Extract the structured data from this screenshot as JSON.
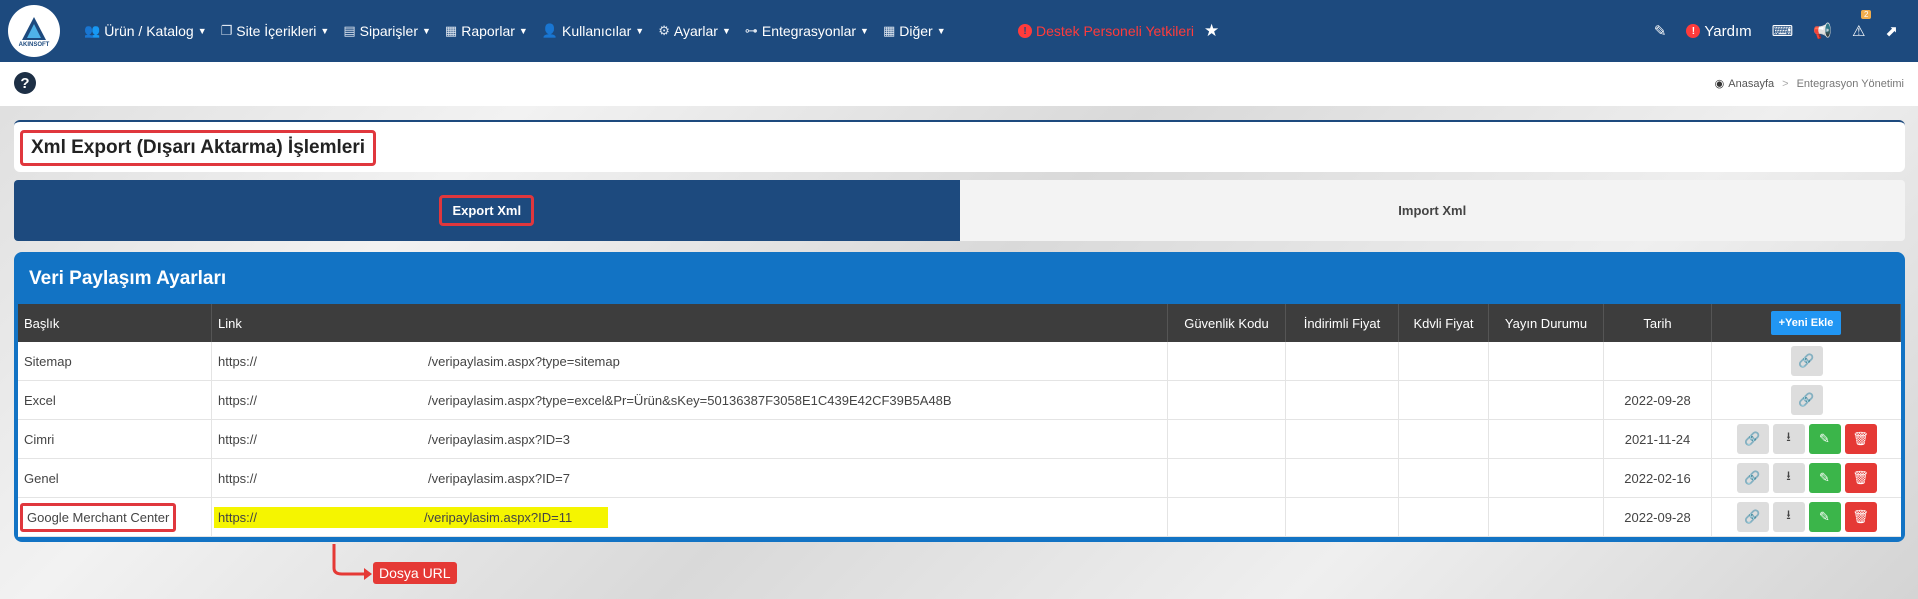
{
  "nav": {
    "logo_text": "AKINSOFT",
    "items": [
      {
        "label": "Ürün / Katalog",
        "icon": "group-icon"
      },
      {
        "label": "Site İçerikleri",
        "icon": "copy-icon"
      },
      {
        "label": "Siparişler",
        "icon": "cart-icon"
      },
      {
        "label": "Raporlar",
        "icon": "report-icon"
      },
      {
        "label": "Kullanıcılar",
        "icon": "users-icon"
      },
      {
        "label": "Ayarlar",
        "icon": "gears-icon"
      },
      {
        "label": "Entegrasyonlar",
        "icon": "sitemap-icon"
      },
      {
        "label": "Diğer",
        "icon": "grid-icon"
      }
    ],
    "support_label": "Destek Personeli Yetkileri",
    "help_label": "Yardım",
    "alert_count": "2"
  },
  "breadcrumb": {
    "home": "Anasayfa",
    "current": "Entegrasyon Yönetimi"
  },
  "page_title": "Xml Export (Dışarı Aktarma) İşlemleri",
  "tabs": {
    "export": "Export Xml",
    "import": "Import Xml"
  },
  "panel_title": "Veri Paylaşım Ayarları",
  "table": {
    "headers": [
      "Başlık",
      "Link",
      "Güvenlik Kodu",
      "İndirimli Fiyat",
      "Kdvli Fiyat",
      "Yayın Durumu",
      "Tarih"
    ],
    "add_label": "+Yeni Ekle",
    "rows": [
      {
        "title": "Sitemap",
        "prefix": "https://",
        "path": "/veripaylasim.aspx?type=sitemap",
        "date": ""
      },
      {
        "title": "Excel",
        "prefix": "https://",
        "path": "/veripaylasim.aspx?type=excel&Pr=Ürün&sKey=50136387F3058E1C439E42CF39B5A48B",
        "date": "2022-09-28"
      },
      {
        "title": "Cimri",
        "prefix": "https://",
        "path": "/veripaylasim.aspx?ID=3",
        "date": "2021-11-24"
      },
      {
        "title": "Genel",
        "prefix": "https://",
        "path": "/veripaylasim.aspx?ID=7",
        "date": "2022-02-16"
      },
      {
        "title": "Google Merchant Center",
        "prefix": "https://",
        "path": "/veripaylasim.aspx?ID=11",
        "date": "2022-09-28"
      }
    ]
  },
  "annotation": "Dosya URL",
  "colors": {
    "navbar": "#1d4a7e",
    "panel": "#1273c4",
    "highlight": "#e0373d",
    "link_highlight": "#f5f500"
  }
}
